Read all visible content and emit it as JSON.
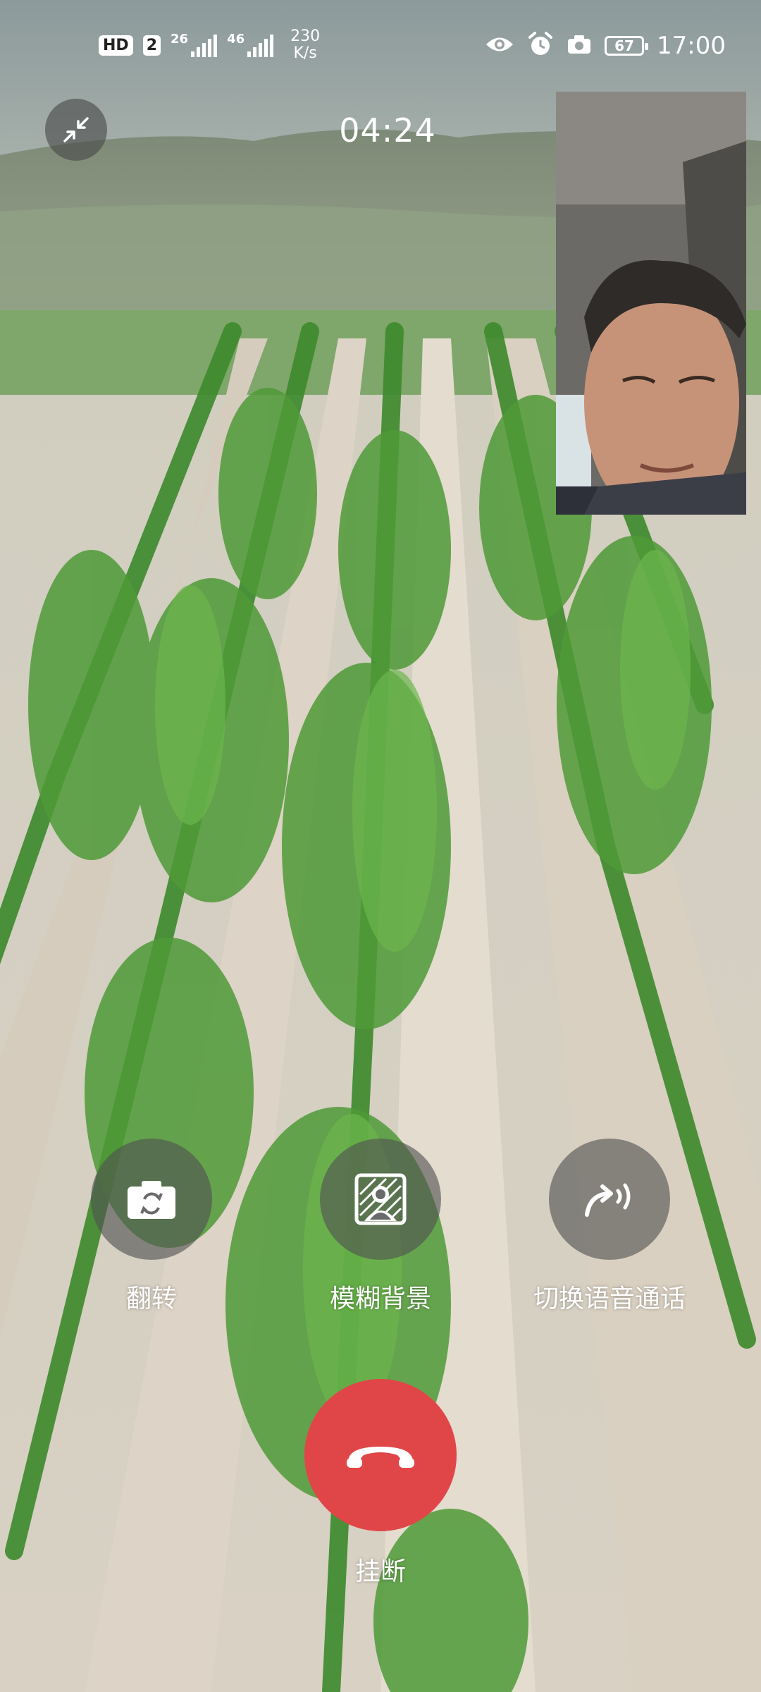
{
  "status_bar": {
    "hd": "HD",
    "sim": "2",
    "net1": "26",
    "net2": "46",
    "speed_value": "230",
    "speed_unit": "K/s",
    "battery": "67",
    "time": "17:00",
    "icons": [
      "eye-icon",
      "alarm-icon",
      "camera-icon"
    ]
  },
  "call": {
    "timer": "04:24"
  },
  "controls": {
    "flip": "翻转",
    "blur": "模糊背景",
    "switch_voice": "切换语音通话",
    "hangup": "挂断"
  },
  "colors": {
    "hangup": "#e04648",
    "button_bg": "#505050"
  }
}
